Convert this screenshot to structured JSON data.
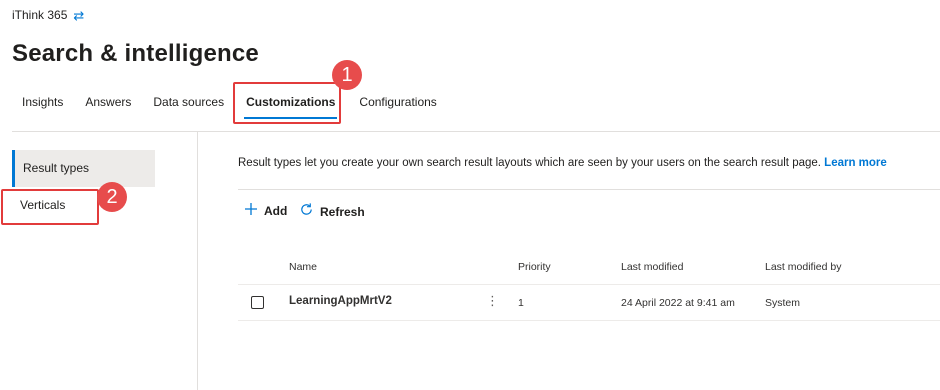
{
  "header": {
    "org_name": "iThink 365",
    "swap_icon": "⇄",
    "title": "Search & intelligence"
  },
  "tabs": [
    {
      "label": "Insights"
    },
    {
      "label": "Answers"
    },
    {
      "label": "Data sources"
    },
    {
      "label": "Customizations",
      "active": true
    },
    {
      "label": "Configurations"
    }
  ],
  "annotations": {
    "badge1": "1",
    "badge2": "2",
    "color": "#e74c4c"
  },
  "sidebar": {
    "items": [
      {
        "label": "Result types",
        "selected": true
      },
      {
        "label": "Verticals"
      }
    ]
  },
  "main": {
    "description": "Result types let you create your own search result layouts which are seen by your users on the search result page.",
    "learn_more": "Learn more",
    "commands": {
      "add": "Add",
      "refresh": "Refresh"
    },
    "table": {
      "headers": {
        "name": "Name",
        "priority": "Priority",
        "last_modified": "Last modified",
        "last_modified_by": "Last modified by"
      },
      "rows": [
        {
          "name": "LearningAppMrtV2",
          "priority": "1",
          "last_modified": "24 April 2022 at 9:41 am",
          "last_modified_by": "System"
        }
      ]
    }
  },
  "colors": {
    "accent": "#0078d4",
    "callout": "#e23b3b"
  }
}
